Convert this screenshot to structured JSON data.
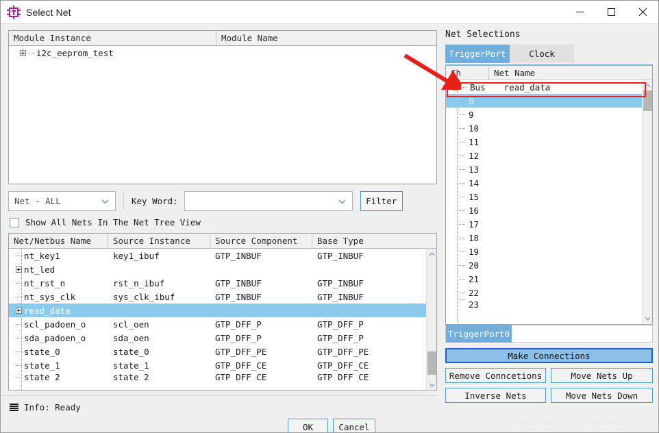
{
  "window": {
    "title": "Select Net",
    "icon": "chip-icon",
    "controls": {
      "minimize": "minimize-icon",
      "maximize": "maximize-icon",
      "close": "close-icon"
    }
  },
  "module_tree": {
    "columns": [
      "Module Instance",
      "Module Name"
    ],
    "rows": [
      {
        "instance": "i2c_eeprom_test",
        "module_name": "",
        "expandable": true
      }
    ]
  },
  "filter": {
    "net_type": "Net - ALL",
    "keyword_label": "Key Word:",
    "keyword_value": "",
    "button": "Filter",
    "show_all_label": "Show All Nets In The Net Tree View",
    "show_all_checked": false
  },
  "net_table": {
    "columns": [
      "Net/Netbus Name",
      "Source Instance",
      "Source Component",
      "Base Type"
    ],
    "sorted_column": "Net/Netbus Name",
    "rows": [
      {
        "name": "nt_key1",
        "source_instance": "key1_ibuf",
        "source_component": "GTP_INBUF",
        "base_type": "GTP_INBUF",
        "expandable": false,
        "selected": false
      },
      {
        "name": "nt_led",
        "source_instance": "",
        "source_component": "",
        "base_type": "",
        "expandable": true,
        "selected": false
      },
      {
        "name": "nt_rst_n",
        "source_instance": "rst_n_ibuf",
        "source_component": "GTP_INBUF",
        "base_type": "GTP_INBUF",
        "expandable": false,
        "selected": false
      },
      {
        "name": "nt_sys_clk",
        "source_instance": "sys_clk_ibuf",
        "source_component": "GTP_INBUF",
        "base_type": "GTP_INBUF",
        "expandable": false,
        "selected": false
      },
      {
        "name": "read_data",
        "source_instance": "",
        "source_component": "",
        "base_type": "",
        "expandable": true,
        "selected": true
      },
      {
        "name": "scl_padoen_o",
        "source_instance": "scl_oen",
        "source_component": "GTP_DFF_P",
        "base_type": "GTP_DFF_P",
        "expandable": false,
        "selected": false
      },
      {
        "name": "sda_padoen_o",
        "source_instance": "sda_oen",
        "source_component": "GTP_DFF_P",
        "base_type": "GTP_DFF_P",
        "expandable": false,
        "selected": false
      },
      {
        "name": "state_0",
        "source_instance": "state_0",
        "source_component": "GTP_DFF_PE",
        "base_type": "GTP_DFF_PE",
        "expandable": false,
        "selected": false
      },
      {
        "name": "state_1",
        "source_instance": "state_1",
        "source_component": "GTP_DFF_CE",
        "base_type": "GTP_DFF_CE",
        "expandable": false,
        "selected": false
      },
      {
        "name": "state_2",
        "source_instance": "state_2",
        "source_component": "GTP_DFF_CE",
        "base_type": "GTP_DFF_CE",
        "expandable": false,
        "selected": false
      }
    ]
  },
  "net_selections": {
    "title": "Net Selections",
    "tabs": [
      {
        "label": "TriggerPort",
        "active": true
      },
      {
        "label": "Clock",
        "active": false
      }
    ],
    "columns": [
      "Ch",
      "Net Name"
    ],
    "rows": [
      {
        "ch": "Bus",
        "net_name": "read_data",
        "expandable": true,
        "highlighted": true,
        "selected": false
      },
      {
        "ch": "8",
        "net_name": "",
        "expandable": false,
        "highlighted": false,
        "selected": true
      },
      {
        "ch": "9",
        "net_name": "",
        "expandable": false,
        "highlighted": false,
        "selected": false
      },
      {
        "ch": "10",
        "net_name": "",
        "expandable": false,
        "highlighted": false,
        "selected": false
      },
      {
        "ch": "11",
        "net_name": "",
        "expandable": false,
        "highlighted": false,
        "selected": false
      },
      {
        "ch": "12",
        "net_name": "",
        "expandable": false,
        "highlighted": false,
        "selected": false
      },
      {
        "ch": "13",
        "net_name": "",
        "expandable": false,
        "highlighted": false,
        "selected": false
      },
      {
        "ch": "14",
        "net_name": "",
        "expandable": false,
        "highlighted": false,
        "selected": false
      },
      {
        "ch": "15",
        "net_name": "",
        "expandable": false,
        "highlighted": false,
        "selected": false
      },
      {
        "ch": "16",
        "net_name": "",
        "expandable": false,
        "highlighted": false,
        "selected": false
      },
      {
        "ch": "17",
        "net_name": "",
        "expandable": false,
        "highlighted": false,
        "selected": false
      },
      {
        "ch": "18",
        "net_name": "",
        "expandable": false,
        "highlighted": false,
        "selected": false
      },
      {
        "ch": "19",
        "net_name": "",
        "expandable": false,
        "highlighted": false,
        "selected": false
      },
      {
        "ch": "20",
        "net_name": "",
        "expandable": false,
        "highlighted": false,
        "selected": false
      },
      {
        "ch": "21",
        "net_name": "",
        "expandable": false,
        "highlighted": false,
        "selected": false
      },
      {
        "ch": "22",
        "net_name": "",
        "expandable": false,
        "highlighted": false,
        "selected": false
      },
      {
        "ch": "23",
        "net_name": "",
        "expandable": false,
        "highlighted": false,
        "selected": false
      }
    ],
    "trigger_port_chip": "TriggerPort0",
    "buttons": {
      "make_connections": "Make Connections",
      "remove_connections": "Remove Conncetions",
      "move_nets_up": "Move Nets Up",
      "inverse_nets": "Inverse Nets",
      "move_nets_down": "Move Nets Down"
    }
  },
  "status": {
    "info": "Info: Ready",
    "icon": "list-icon"
  },
  "dialog_buttons": {
    "ok": "OK",
    "cancel": "Cancel"
  },
  "annotation": {
    "arrow_color": "#e8201a",
    "highlight_color": "#e8201a",
    "target": "Bus read_data"
  },
  "watermark": "https://blog.csdn.net/ReCclay",
  "colors": {
    "accent_blue": "#70aedd",
    "selection_blue": "#89caed",
    "button_border": "#4b9ed4",
    "primary_border": "#1b5fd0",
    "annotation_red": "#e8201a",
    "title_icon_purple": "#a0259c"
  }
}
